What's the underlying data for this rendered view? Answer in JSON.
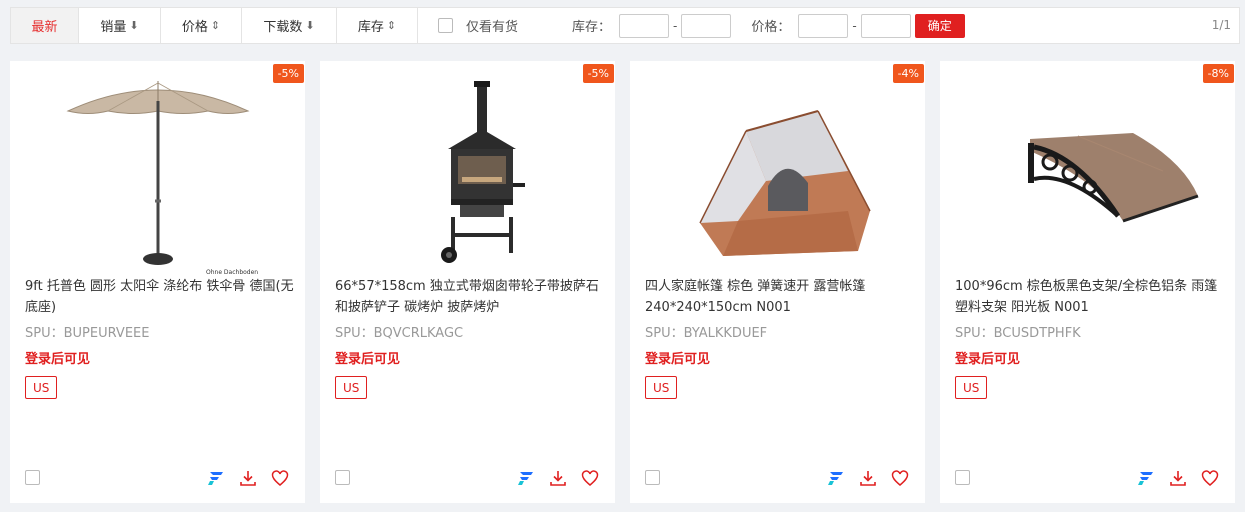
{
  "filter": {
    "tabs": [
      {
        "label": "最新",
        "arrow": ""
      },
      {
        "label": "销量",
        "arrow": "⬇"
      },
      {
        "label": "价格",
        "arrow": "⇕"
      },
      {
        "label": "下载数",
        "arrow": "⬇"
      },
      {
        "label": "库存",
        "arrow": "⇕"
      }
    ],
    "in_stock_label": "仅看有货",
    "stock_label": "库存：",
    "price_label": "价格：",
    "dash": "-",
    "confirm_label": "确定",
    "pager": "1/1"
  },
  "products": [
    {
      "discount": "-5%",
      "title": "9ft 托普色 圆形 太阳伞 涤纶布 铁伞骨 德国(无底座)",
      "spu": "SPU：BUPEURVEEE",
      "login_text": "登录后可见",
      "country": "US",
      "image": "patio-umbrella",
      "image_caption": "Ohne Dachboden"
    },
    {
      "discount": "-5%",
      "title": "66*57*158cm 独立式带烟囱带轮子带披萨石和披萨铲子 碳烤炉 披萨烤炉",
      "spu": "SPU：BQVCRLKAGC",
      "login_text": "登录后可见",
      "country": "US",
      "image": "pizza-oven"
    },
    {
      "discount": "-4%",
      "title": "四人家庭帐篷 棕色 弹簧速开 露营帐篷 240*240*150cm N001",
      "spu": "SPU：BYALKKDUEF",
      "login_text": "登录后可见",
      "country": "US",
      "image": "tent"
    },
    {
      "discount": "-8%",
      "title": "100*96cm 棕色板黑色支架/全棕色铝条 雨篷 塑料支架 阳光板 N001",
      "spu": "SPU：BCUSDTPHFK",
      "login_text": "登录后可见",
      "country": "US",
      "image": "door-canopy"
    }
  ],
  "colors": {
    "accent": "#e02020",
    "discount": "#f0561c"
  }
}
